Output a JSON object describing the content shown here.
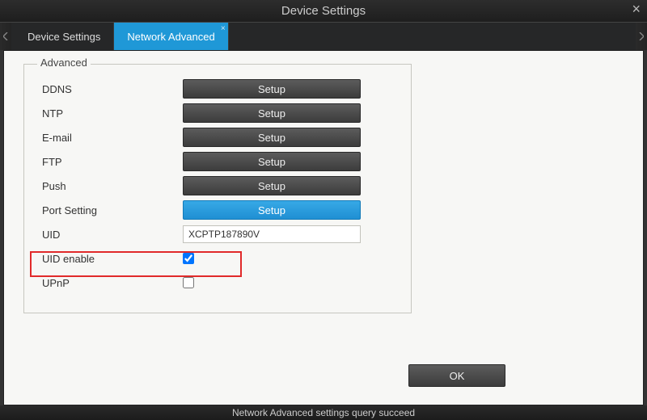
{
  "window": {
    "title": "Device Settings"
  },
  "tabs": [
    {
      "label": "Device Settings",
      "active": false
    },
    {
      "label": "Network Advanced",
      "active": true
    }
  ],
  "group": {
    "legend": "Advanced"
  },
  "rows": {
    "ddns": {
      "label": "DDNS",
      "button": "Setup",
      "active": false
    },
    "ntp": {
      "label": "NTP",
      "button": "Setup",
      "active": false
    },
    "email": {
      "label": "E-mail",
      "button": "Setup",
      "active": false
    },
    "ftp": {
      "label": "FTP",
      "button": "Setup",
      "active": false
    },
    "push": {
      "label": "Push",
      "button": "Setup",
      "active": false
    },
    "port": {
      "label": "Port Setting",
      "button": "Setup",
      "active": true
    },
    "uid": {
      "label": "UID",
      "value": "XCPTP187890V"
    },
    "uid_enable": {
      "label": "UID enable",
      "checked": true
    },
    "upnp": {
      "label": "UPnP",
      "checked": false
    }
  },
  "actions": {
    "ok": "OK"
  },
  "status": "Network Advanced settings query succeed"
}
